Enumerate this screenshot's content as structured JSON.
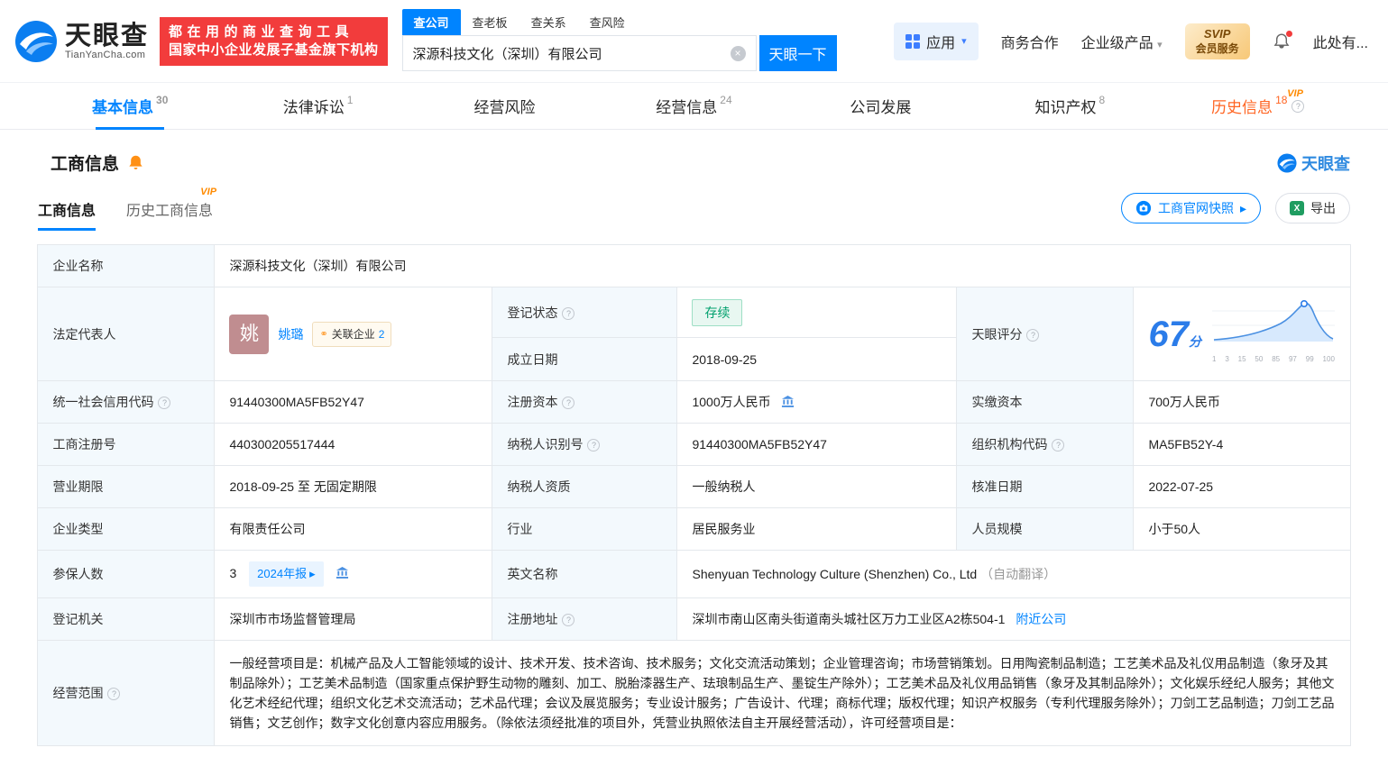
{
  "palette": {
    "brand_blue": "#0084ff",
    "promo_red": "#f23c3c",
    "vip_orange": "#ff8a00",
    "status_green": "#00a06d",
    "history_orange": "#ff6421"
  },
  "header": {
    "logo_cn": "天眼查",
    "logo_en": "TianYanCha.com",
    "promo_line1": "都在用的商业查询工具",
    "promo_line2": "国家中小企业发展子基金旗下机构",
    "search_tabs": [
      {
        "label": "查公司"
      },
      {
        "label": "查老板"
      },
      {
        "label": "查关系"
      },
      {
        "label": "查风险"
      }
    ],
    "search_value": "深源科技文化（深圳）有限公司",
    "search_button": "天眼一下",
    "apps_label": "应用",
    "link_cooperation": "商务合作",
    "link_enterprise": "企业级产品",
    "svip_line1": "SVIP",
    "svip_line2": "会员服务",
    "user_text": "此处有..."
  },
  "nav_tabs": [
    {
      "label": "基本信息",
      "count": "30"
    },
    {
      "label": "法律诉讼",
      "count": "1"
    },
    {
      "label": "经营风险",
      "count": ""
    },
    {
      "label": "经营信息",
      "count": "24"
    },
    {
      "label": "公司发展",
      "count": ""
    },
    {
      "label": "知识产权",
      "count": "8"
    },
    {
      "label": "历史信息",
      "count": "18",
      "vip": "VIP"
    }
  ],
  "section": {
    "title": "工商信息",
    "brand_mark": "天眼查",
    "tab_current": "工商信息",
    "tab_history": "历史工商信息",
    "history_vip": "VIP",
    "snapshot_button": "工商官网快照",
    "snapshot_arrow": "▸",
    "export_button": "导出"
  },
  "table": {
    "company_name_label": "企业名称",
    "company_name": "深源科技文化（深圳）有限公司",
    "legal_rep_label": "法定代表人",
    "legal_rep_avatar": "姚",
    "legal_rep_name": "姚璐",
    "related_label": "关联企业",
    "related_count": "2",
    "reg_status_label": "登记状态",
    "reg_status": "存续",
    "establish_label": "成立日期",
    "establish_date": "2018-09-25",
    "score_label": "天眼评分",
    "score_value": "67",
    "score_unit": "分",
    "score_ticks": [
      "1",
      "3",
      "15",
      "50",
      "85",
      "97",
      "99",
      "100"
    ],
    "credit_code_label": "统一社会信用代码",
    "credit_code": "91440300MA5FB52Y47",
    "reg_capital_label": "注册资本",
    "reg_capital": "1000万人民币",
    "paid_capital_label": "实缴资本",
    "paid_capital": "700万人民币",
    "reg_number_label": "工商注册号",
    "reg_number": "440300205517444",
    "taxpayer_id_label": "纳税人识别号",
    "taxpayer_id": "91440300MA5FB52Y47",
    "org_code_label": "组织机构代码",
    "org_code": "MA5FB52Y-4",
    "business_term_label": "营业期限",
    "business_term": "2018-09-25 至 无固定期限",
    "taxpayer_quality_label": "纳税人资质",
    "taxpayer_quality": "一般纳税人",
    "approval_date_label": "核准日期",
    "approval_date": "2022-07-25",
    "company_type_label": "企业类型",
    "company_type": "有限责任公司",
    "industry_label": "行业",
    "industry": "居民服务业",
    "staff_size_label": "人员规模",
    "staff_size": "小于50人",
    "insured_label": "参保人数",
    "insured_count": "3",
    "annual_report_badge": "2024年报",
    "annual_report_arrow": "▸",
    "english_name_label": "英文名称",
    "english_name": "Shenyuan Technology Culture (Shenzhen) Co., Ltd",
    "auto_translate": "（自动翻译）",
    "registry_label": "登记机关",
    "registry": "深圳市市场监督管理局",
    "address_label": "注册地址",
    "address": "深圳市南山区南头街道南头城社区万力工业区A2栋504-1",
    "nearby_link": "附近公司",
    "business_scope_label": "经营范围",
    "business_scope": "一般经营项目是：机械产品及人工智能领域的设计、技术开发、技术咨询、技术服务；文化交流活动策划；企业管理咨询；市场营销策划。日用陶瓷制品制造；工艺美术品及礼仪用品制造（象牙及其制品除外）；工艺美术品制造（国家重点保护野生动物的雕刻、加工、脱胎漆器生产、珐琅制品生产、墨锭生产除外）；工艺美术品及礼仪用品销售（象牙及其制品除外）；文化娱乐经纪人服务；其他文化艺术经纪代理；组织文化艺术交流活动；艺术品代理；会议及展览服务；专业设计服务；广告设计、代理；商标代理；版权代理；知识产权服务（专利代理服务除外）；刀剑工艺品制造；刀剑工艺品销售；文艺创作；数字文化创意内容应用服务。（除依法须经批准的项目外，凭营业执照依法自主开展经营活动），许可经营项目是："
  }
}
